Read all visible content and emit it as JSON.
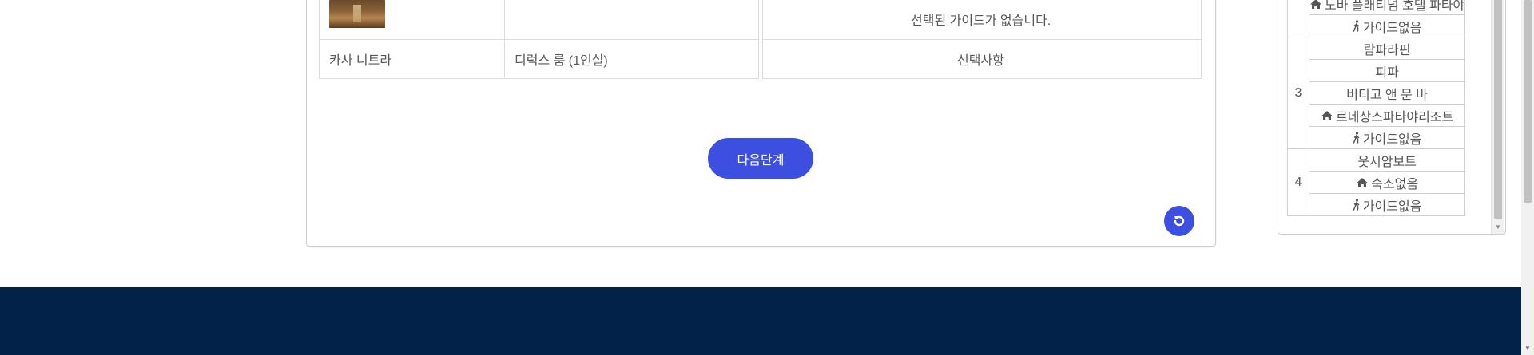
{
  "summary": {
    "guide_empty_text": "선택된 가이드가 없습니다.",
    "hotel_name": "카사 니트라",
    "room_type": "디럭스 룸 (1인실)",
    "options_label": "선택사항"
  },
  "buttons": {
    "next_label": "다음단계"
  },
  "itinerary": {
    "day2_tail": [
      {
        "icon": "home-icon",
        "label": "노바 플래티넘 호텔 파타야"
      },
      {
        "icon": "walking-person-icon",
        "label": "가이드없음"
      }
    ],
    "days": [
      {
        "day": "3",
        "items": [
          {
            "icon": "",
            "label": "람파라핀"
          },
          {
            "icon": "",
            "label": "피파"
          },
          {
            "icon": "",
            "label": "버티고 앤 문 바"
          },
          {
            "icon": "home-icon",
            "label": "르네상스파타야리조트"
          },
          {
            "icon": "walking-person-icon",
            "label": "가이드없음"
          }
        ]
      },
      {
        "day": "4",
        "items": [
          {
            "icon": "",
            "label": "웃시암보트"
          },
          {
            "icon": "home-icon",
            "label": "숙소없음"
          },
          {
            "icon": "walking-person-icon",
            "label": "가이드없음"
          }
        ]
      }
    ]
  },
  "colors": {
    "accent": "#3c4fe0",
    "footer": "#022249",
    "border": "#dcdcdc"
  }
}
